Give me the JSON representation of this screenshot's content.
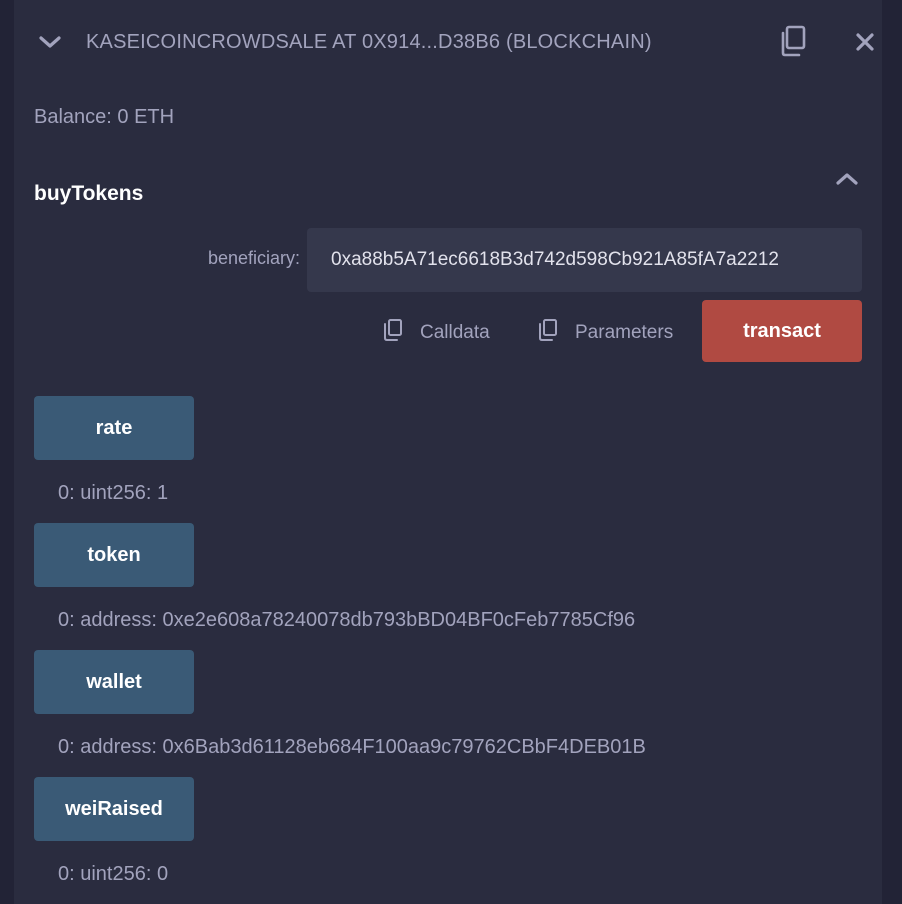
{
  "header": {
    "title": "KASEICOINCROWDSALE AT 0X914...D38B6 (BLOCKCHAIN)"
  },
  "balance": "Balance: 0 ETH",
  "buy_tokens": {
    "title": "buyTokens",
    "param_label": "beneficiary:",
    "param_value": "0xa88b5A71ec6618B3d742d598Cb921A85fA7a2212",
    "calldata_label": "Calldata",
    "parameters_label": "Parameters",
    "transact_label": "transact"
  },
  "calls": [
    {
      "label": "rate",
      "result": "0: uint256: 1"
    },
    {
      "label": "token",
      "result": "0: address: 0xe2e608a78240078db793bBD04BF0cFeb7785Cf96"
    },
    {
      "label": "wallet",
      "result": "0: address: 0x6Bab3d61128eb684F100aa9c79762CBbF4DEB01B"
    },
    {
      "label": "weiRaised",
      "result": "0: uint256: 0"
    }
  ],
  "colors": {
    "background": "#222336",
    "panel": "#2a2c3f",
    "text_muted": "#a2a3bd",
    "input_bg": "#35384c",
    "call_button": "#3a5a76",
    "transact_button": "#b04a42"
  },
  "icons": [
    "chevron-down-icon",
    "copy-icon",
    "close-icon",
    "chevron-up-icon"
  ]
}
